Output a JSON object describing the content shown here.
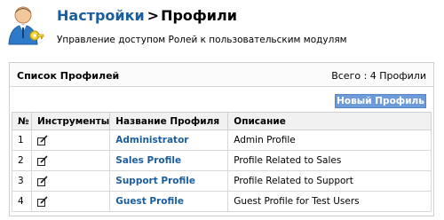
{
  "header": {
    "breadcrumb_link": "Настройки",
    "breadcrumb_sep": ">",
    "breadcrumb_current": "Профили",
    "subtitle": "Управление доступом Ролей к пользовательским модулям",
    "avatar_icon": "user-key-icon"
  },
  "panel": {
    "title": "Список Профилей",
    "total": "Всего : 4 Профили",
    "new_button": "Новый Профиль"
  },
  "table": {
    "headers": [
      "№",
      "Инструменты",
      "Название Профиля",
      "Описание"
    ],
    "tool_icon": "edit-icon",
    "rows": [
      {
        "num": "1",
        "name": "Administrator",
        "description": "Admin Profile"
      },
      {
        "num": "2",
        "name": "Sales Profile",
        "description": "Profile Related to Sales"
      },
      {
        "num": "3",
        "name": "Support Profile",
        "description": "Profile Related to Support"
      },
      {
        "num": "4",
        "name": "Guest Profile",
        "description": "Guest Profile for Test Users"
      }
    ]
  },
  "colors": {
    "link": "#1a5e9e",
    "button": "#6d9bd9",
    "header_bg": "#f1f1f1"
  }
}
